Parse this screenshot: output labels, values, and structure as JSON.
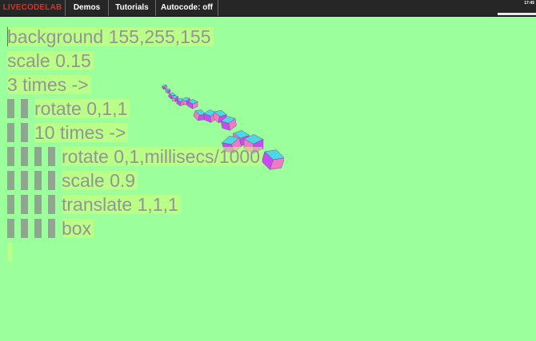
{
  "menu": {
    "logo": "LIVECODELAB",
    "demos": "Demos",
    "tutorials": "Tutorials",
    "autocode": "Autocode: off"
  },
  "clock": {
    "text": "17:45"
  },
  "editor": {
    "lines": [
      {
        "text": "background 155,255,155",
        "indent": 0
      },
      {
        "text": "scale 0.15",
        "indent": 0
      },
      {
        "text": "3 times ->",
        "indent": 0
      },
      {
        "text": "rotate 0,1,1",
        "indent": 1
      },
      {
        "text": "10 times ->",
        "indent": 1
      },
      {
        "text": "rotate 0,1,millisecs/1000",
        "indent": 2
      },
      {
        "text": "scale 0.9",
        "indent": 2
      },
      {
        "text": "translate 1,1,1",
        "indent": 2
      },
      {
        "text": "box",
        "indent": 2
      }
    ]
  },
  "colors": {
    "background": "#9bff9b",
    "logo": "#e03020",
    "code_text": "#949494",
    "cube_cyan": "#4fd6e6",
    "cube_magenta": "#c84cf0",
    "cube_pink": "#f07ac8"
  }
}
